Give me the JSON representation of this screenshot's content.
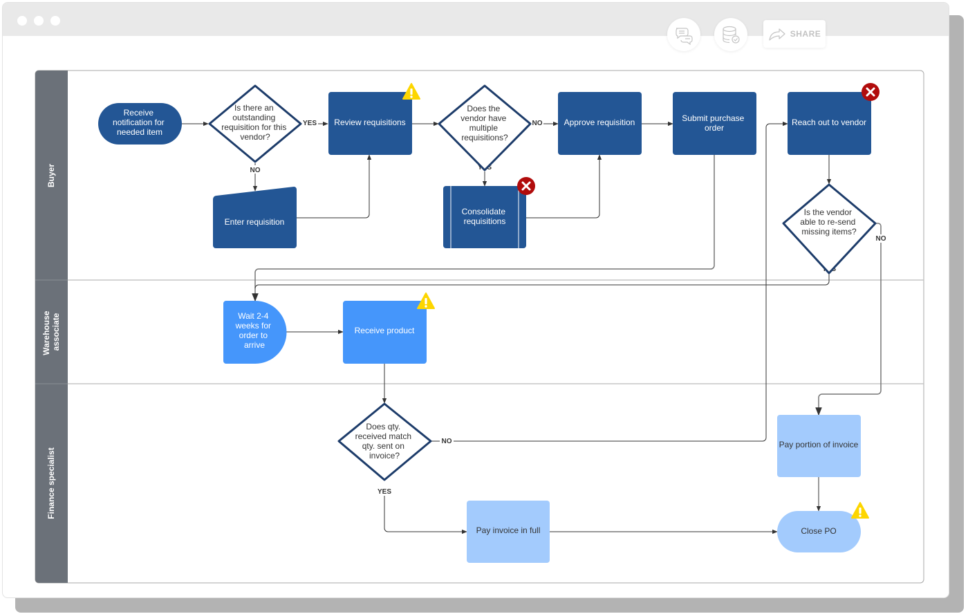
{
  "window": {
    "toolbar": {
      "comments_icon": "chat-bubbles-icon",
      "data_icon": "database-check-icon",
      "share_label": "SHARE",
      "share_icon": "share-arrow-icon"
    }
  },
  "colors": {
    "dark_blue": "#235695",
    "mid_blue": "#4596fb",
    "light_blue": "#a3cbfd",
    "decision_border": "#1d3c6a",
    "lane_header": "#6b7179",
    "warning": "#fdd600",
    "error": "#b10c0c",
    "connector": "#333333"
  },
  "diagram": {
    "lanes": [
      {
        "id": "buyer",
        "label": "Buyer"
      },
      {
        "id": "warehouse",
        "label": [
          "Warehouse",
          "associate"
        ]
      },
      {
        "id": "finance",
        "label": "Finance specialist"
      }
    ],
    "nodes": {
      "receive_notification": {
        "lines": [
          "Receive",
          "notification for",
          "needed item"
        ],
        "shape": "terminator",
        "lane": "buyer"
      },
      "outstanding_req": {
        "lines": [
          "Is there an",
          "outstanding",
          "requisition for this",
          "vendor?"
        ],
        "shape": "decision",
        "lane": "buyer"
      },
      "review_reqs": {
        "lines": [
          "Review requisitions"
        ],
        "shape": "process",
        "lane": "buyer",
        "badge": "warning"
      },
      "multiple_reqs": {
        "lines": [
          "Does the",
          "vendor have",
          "multiple",
          "requisitions?"
        ],
        "shape": "decision",
        "lane": "buyer"
      },
      "approve_req": {
        "lines": [
          "Approve requisition"
        ],
        "shape": "process",
        "lane": "buyer"
      },
      "submit_po": {
        "lines": [
          "Submit purchase",
          "order"
        ],
        "shape": "process",
        "lane": "buyer"
      },
      "reach_vendor": {
        "lines": [
          "Reach out to vendor"
        ],
        "shape": "process",
        "lane": "buyer",
        "badge": "error"
      },
      "enter_req": {
        "lines": [
          "Enter requisition"
        ],
        "shape": "manual-input",
        "lane": "buyer"
      },
      "consolidate_reqs": {
        "lines": [
          "Consolidate",
          "requisitions"
        ],
        "shape": "predefined-process",
        "lane": "buyer",
        "badge": "error"
      },
      "vendor_resend": {
        "lines": [
          "Is the vendor",
          "able to re-send",
          "missing items?"
        ],
        "shape": "decision",
        "lane": "buyer"
      },
      "wait_weeks": {
        "lines": [
          "Wait 2-4",
          "weeks for",
          "order to",
          "arrive"
        ],
        "shape": "delay",
        "lane": "warehouse"
      },
      "receive_product": {
        "lines": [
          "Receive product"
        ],
        "shape": "process",
        "lane": "warehouse",
        "badge": "warning"
      },
      "qty_match": {
        "lines": [
          "Does qty.",
          "received match",
          "qty. sent on",
          "invoice?"
        ],
        "shape": "decision",
        "lane": "finance"
      },
      "pay_full": {
        "lines": [
          "Pay invoice in full"
        ],
        "shape": "process",
        "lane": "finance"
      },
      "pay_portion": {
        "lines": [
          "Pay portion of invoice"
        ],
        "shape": "process",
        "lane": "finance"
      },
      "close_po": {
        "lines": [
          "Close PO"
        ],
        "shape": "terminator",
        "lane": "finance",
        "badge": "warning"
      }
    },
    "edges": [
      {
        "from": "receive_notification",
        "to": "outstanding_req",
        "label": ""
      },
      {
        "from": "outstanding_req",
        "to": "review_reqs",
        "label": "YES"
      },
      {
        "from": "outstanding_req",
        "to": "enter_req",
        "label": "NO"
      },
      {
        "from": "enter_req",
        "to": "review_reqs",
        "label": ""
      },
      {
        "from": "review_reqs",
        "to": "multiple_reqs",
        "label": ""
      },
      {
        "from": "multiple_reqs",
        "to": "approve_req",
        "label": "NO"
      },
      {
        "from": "multiple_reqs",
        "to": "consolidate_reqs",
        "label": "YES"
      },
      {
        "from": "consolidate_reqs",
        "to": "approve_req",
        "label": ""
      },
      {
        "from": "approve_req",
        "to": "submit_po",
        "label": ""
      },
      {
        "from": "submit_po",
        "to": "wait_weeks",
        "label": ""
      },
      {
        "from": "reach_vendor",
        "to": "vendor_resend",
        "label": ""
      },
      {
        "from": "vendor_resend",
        "to": "wait_weeks",
        "label": "YES"
      },
      {
        "from": "vendor_resend",
        "to": "pay_portion",
        "label": "NO"
      },
      {
        "from": "wait_weeks",
        "to": "receive_product",
        "label": ""
      },
      {
        "from": "receive_product",
        "to": "qty_match",
        "label": ""
      },
      {
        "from": "qty_match",
        "to": "reach_vendor",
        "label": "NO"
      },
      {
        "from": "qty_match",
        "to": "pay_full",
        "label": "YES"
      },
      {
        "from": "pay_full",
        "to": "close_po",
        "label": ""
      },
      {
        "from": "pay_portion",
        "to": "close_po",
        "label": ""
      }
    ]
  }
}
